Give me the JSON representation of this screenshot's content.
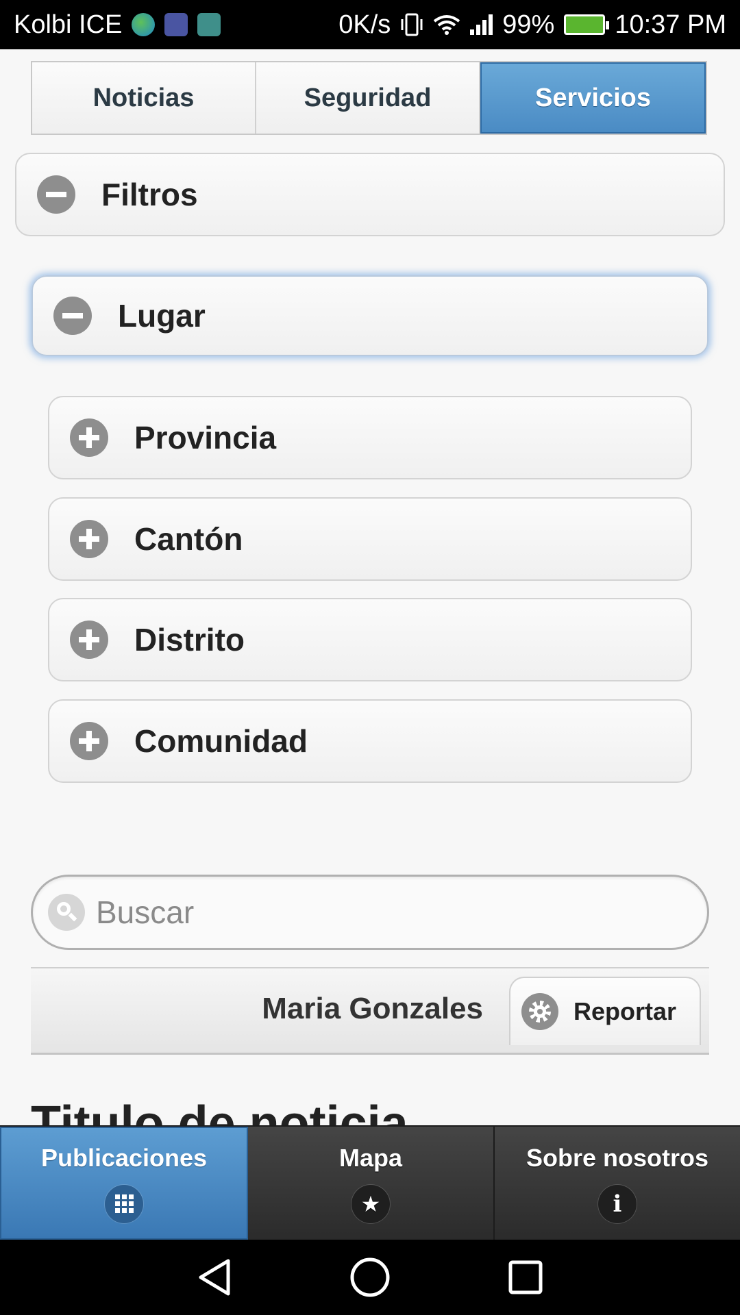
{
  "status_bar": {
    "carrier": "Kolbi ICE",
    "net_speed": "0K/s",
    "battery": "99%",
    "time": "10:37 PM",
    "icons": [
      "globe-icon",
      "health-icon",
      "gallery-icon",
      "vibrate-icon",
      "wifi-icon",
      "signal-icon",
      "battery-charging-icon"
    ]
  },
  "tabs": [
    {
      "label": "Noticias",
      "active": false
    },
    {
      "label": "Seguridad",
      "active": false
    },
    {
      "label": "Servicios",
      "active": true
    }
  ],
  "filters": {
    "header": "Filtros",
    "state": "expanded",
    "lugar": {
      "header": "Lugar",
      "state": "expanded",
      "items": [
        "Provincia",
        "Cantón",
        "Distrito",
        "Comunidad"
      ]
    }
  },
  "search": {
    "placeholder": "Buscar",
    "value": ""
  },
  "user_bar": {
    "name": "Maria Gonzales",
    "report_label": "Reportar"
  },
  "article": {
    "title": "Titulo de noticia"
  },
  "bottom_nav": [
    {
      "label": "Publicaciones",
      "icon": "grid-icon",
      "active": true
    },
    {
      "label": "Mapa",
      "icon": "star-icon",
      "active": false
    },
    {
      "label": "Sobre nosotros",
      "icon": "info-icon",
      "active": false
    }
  ],
  "colors": {
    "accent": "#4a8bc4",
    "navbar": "#2f2f2f",
    "icon_gray": "#8e8e8e"
  }
}
